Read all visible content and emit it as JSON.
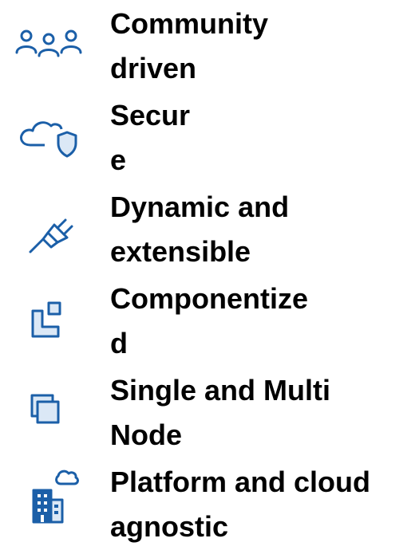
{
  "features": [
    {
      "label": "Community\ndriven",
      "icon": "people-group-icon"
    },
    {
      "label": "Secur\ne",
      "icon": "cloud-shield-icon"
    },
    {
      "label": "Dynamic and\nextensible",
      "icon": "plug-icon"
    },
    {
      "label": "Componentize\nd",
      "icon": "components-icon"
    },
    {
      "label": "Single and Multi\nNode",
      "icon": "stacked-squares-icon"
    },
    {
      "label": "Platform and cloud\nagnostic",
      "icon": "building-cloud-icon"
    }
  ],
  "colors": {
    "icon_stroke": "#1b5fa8",
    "icon_fill": "#dbe8f6",
    "text": "#000000"
  }
}
